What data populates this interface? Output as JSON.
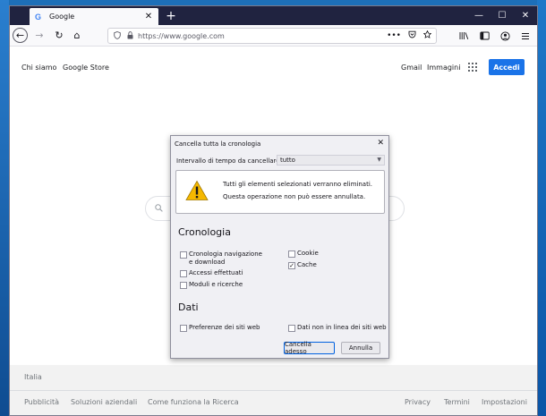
{
  "tab": {
    "favicon": "G",
    "title": "Google",
    "close": "✕"
  },
  "newtab": "+",
  "window_controls": {
    "minimize": "—",
    "maximize": "☐",
    "close": "✕"
  },
  "nav": {
    "back": "←",
    "forward": "→",
    "reload": "↻",
    "home": "⌂"
  },
  "urlbar": {
    "url": "https://www.google.com",
    "more": "•••"
  },
  "google": {
    "about": "Chi siamo",
    "store": "Google Store",
    "gmail": "Gmail",
    "images": "Immagini",
    "signin": "Accedi"
  },
  "footer": {
    "country": "Italia",
    "left_links": [
      "Pubblicità",
      "Soluzioni aziendali",
      "Come funziona la Ricerca"
    ],
    "right_links": [
      "Privacy",
      "Termini",
      "Impostazioni"
    ]
  },
  "dialog": {
    "title": "Cancella tutta la cronologia",
    "close": "✕",
    "range_label": "Intervallo di tempo da cancellare:",
    "range_value": "tutto",
    "warning_line1": "Tutti gli elementi selezionati verranno eliminati.",
    "warning_line2": "Questa operazione non può essere annullata.",
    "history_title": "Cronologia",
    "history_items": [
      {
        "label": "Cronologia navigazione e download",
        "checked": false
      },
      {
        "label": "Accessi effettuati",
        "checked": false
      },
      {
        "label": "Moduli e ricerche",
        "checked": false
      },
      {
        "label": "Cookie",
        "checked": false
      },
      {
        "label": "Cache",
        "checked": true
      }
    ],
    "data_title": "Dati",
    "data_items": [
      {
        "label": "Preferenze dei siti web",
        "checked": false
      },
      {
        "label": "Dati non in linea dei siti web",
        "checked": false
      }
    ],
    "confirm_button": "Cancella adesso",
    "cancel_button": "Annulla"
  },
  "colors": {
    "accent": "#1a73e8",
    "tabbar": "#202340",
    "warning": "#f5b800"
  }
}
